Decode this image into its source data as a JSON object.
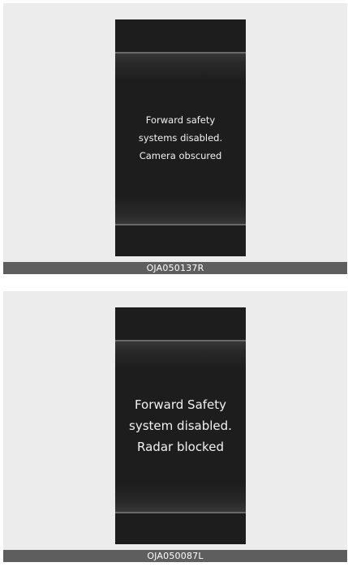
{
  "figures": [
    {
      "message_lines": [
        "Forward safety",
        "systems disabled.",
        "Camera obscured"
      ],
      "caption": "OJA050137R"
    },
    {
      "message_lines": [
        "Forward Safety",
        "system disabled.",
        "Radar blocked"
      ],
      "caption": "OJA050087L"
    }
  ]
}
